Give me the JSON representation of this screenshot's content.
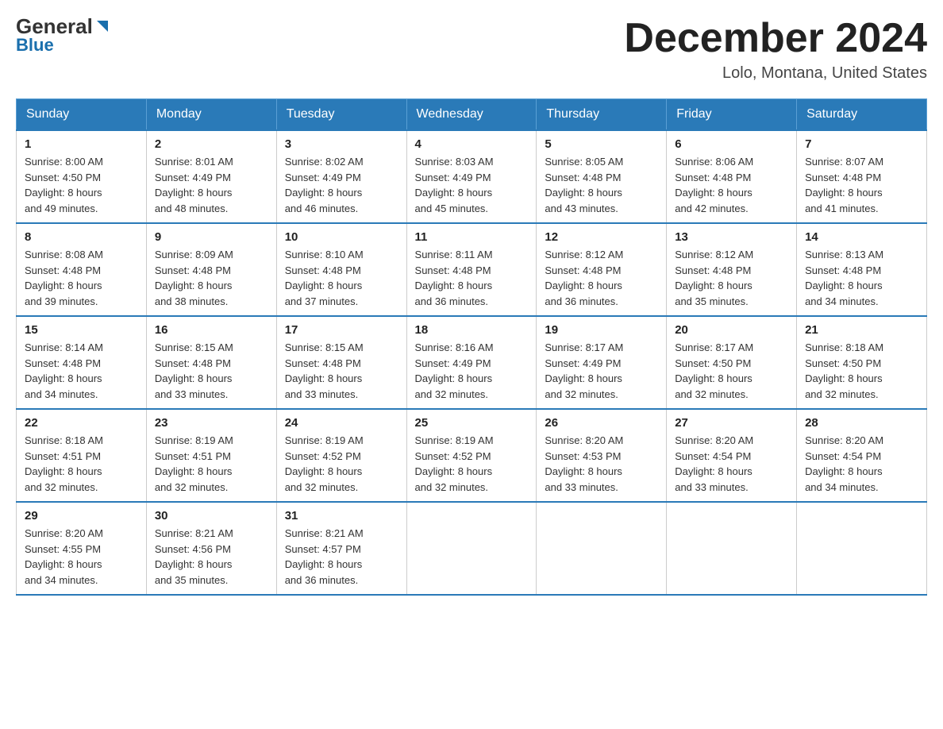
{
  "header": {
    "logo_general": "General",
    "logo_blue": "Blue",
    "month_title": "December 2024",
    "location": "Lolo, Montana, United States"
  },
  "weekdays": [
    "Sunday",
    "Monday",
    "Tuesday",
    "Wednesday",
    "Thursday",
    "Friday",
    "Saturday"
  ],
  "weeks": [
    [
      {
        "day": "1",
        "sunrise": "8:00 AM",
        "sunset": "4:50 PM",
        "daylight": "8 hours and 49 minutes."
      },
      {
        "day": "2",
        "sunrise": "8:01 AM",
        "sunset": "4:49 PM",
        "daylight": "8 hours and 48 minutes."
      },
      {
        "day": "3",
        "sunrise": "8:02 AM",
        "sunset": "4:49 PM",
        "daylight": "8 hours and 46 minutes."
      },
      {
        "day": "4",
        "sunrise": "8:03 AM",
        "sunset": "4:49 PM",
        "daylight": "8 hours and 45 minutes."
      },
      {
        "day": "5",
        "sunrise": "8:05 AM",
        "sunset": "4:48 PM",
        "daylight": "8 hours and 43 minutes."
      },
      {
        "day": "6",
        "sunrise": "8:06 AM",
        "sunset": "4:48 PM",
        "daylight": "8 hours and 42 minutes."
      },
      {
        "day": "7",
        "sunrise": "8:07 AM",
        "sunset": "4:48 PM",
        "daylight": "8 hours and 41 minutes."
      }
    ],
    [
      {
        "day": "8",
        "sunrise": "8:08 AM",
        "sunset": "4:48 PM",
        "daylight": "8 hours and 39 minutes."
      },
      {
        "day": "9",
        "sunrise": "8:09 AM",
        "sunset": "4:48 PM",
        "daylight": "8 hours and 38 minutes."
      },
      {
        "day": "10",
        "sunrise": "8:10 AM",
        "sunset": "4:48 PM",
        "daylight": "8 hours and 37 minutes."
      },
      {
        "day": "11",
        "sunrise": "8:11 AM",
        "sunset": "4:48 PM",
        "daylight": "8 hours and 36 minutes."
      },
      {
        "day": "12",
        "sunrise": "8:12 AM",
        "sunset": "4:48 PM",
        "daylight": "8 hours and 36 minutes."
      },
      {
        "day": "13",
        "sunrise": "8:12 AM",
        "sunset": "4:48 PM",
        "daylight": "8 hours and 35 minutes."
      },
      {
        "day": "14",
        "sunrise": "8:13 AM",
        "sunset": "4:48 PM",
        "daylight": "8 hours and 34 minutes."
      }
    ],
    [
      {
        "day": "15",
        "sunrise": "8:14 AM",
        "sunset": "4:48 PM",
        "daylight": "8 hours and 34 minutes."
      },
      {
        "day": "16",
        "sunrise": "8:15 AM",
        "sunset": "4:48 PM",
        "daylight": "8 hours and 33 minutes."
      },
      {
        "day": "17",
        "sunrise": "8:15 AM",
        "sunset": "4:48 PM",
        "daylight": "8 hours and 33 minutes."
      },
      {
        "day": "18",
        "sunrise": "8:16 AM",
        "sunset": "4:49 PM",
        "daylight": "8 hours and 32 minutes."
      },
      {
        "day": "19",
        "sunrise": "8:17 AM",
        "sunset": "4:49 PM",
        "daylight": "8 hours and 32 minutes."
      },
      {
        "day": "20",
        "sunrise": "8:17 AM",
        "sunset": "4:50 PM",
        "daylight": "8 hours and 32 minutes."
      },
      {
        "day": "21",
        "sunrise": "8:18 AM",
        "sunset": "4:50 PM",
        "daylight": "8 hours and 32 minutes."
      }
    ],
    [
      {
        "day": "22",
        "sunrise": "8:18 AM",
        "sunset": "4:51 PM",
        "daylight": "8 hours and 32 minutes."
      },
      {
        "day": "23",
        "sunrise": "8:19 AM",
        "sunset": "4:51 PM",
        "daylight": "8 hours and 32 minutes."
      },
      {
        "day": "24",
        "sunrise": "8:19 AM",
        "sunset": "4:52 PM",
        "daylight": "8 hours and 32 minutes."
      },
      {
        "day": "25",
        "sunrise": "8:19 AM",
        "sunset": "4:52 PM",
        "daylight": "8 hours and 32 minutes."
      },
      {
        "day": "26",
        "sunrise": "8:20 AM",
        "sunset": "4:53 PM",
        "daylight": "8 hours and 33 minutes."
      },
      {
        "day": "27",
        "sunrise": "8:20 AM",
        "sunset": "4:54 PM",
        "daylight": "8 hours and 33 minutes."
      },
      {
        "day": "28",
        "sunrise": "8:20 AM",
        "sunset": "4:54 PM",
        "daylight": "8 hours and 34 minutes."
      }
    ],
    [
      {
        "day": "29",
        "sunrise": "8:20 AM",
        "sunset": "4:55 PM",
        "daylight": "8 hours and 34 minutes."
      },
      {
        "day": "30",
        "sunrise": "8:21 AM",
        "sunset": "4:56 PM",
        "daylight": "8 hours and 35 minutes."
      },
      {
        "day": "31",
        "sunrise": "8:21 AM",
        "sunset": "4:57 PM",
        "daylight": "8 hours and 36 minutes."
      },
      null,
      null,
      null,
      null
    ]
  ],
  "labels": {
    "sunrise_prefix": "Sunrise: ",
    "sunset_prefix": "Sunset: ",
    "daylight_prefix": "Daylight: "
  }
}
